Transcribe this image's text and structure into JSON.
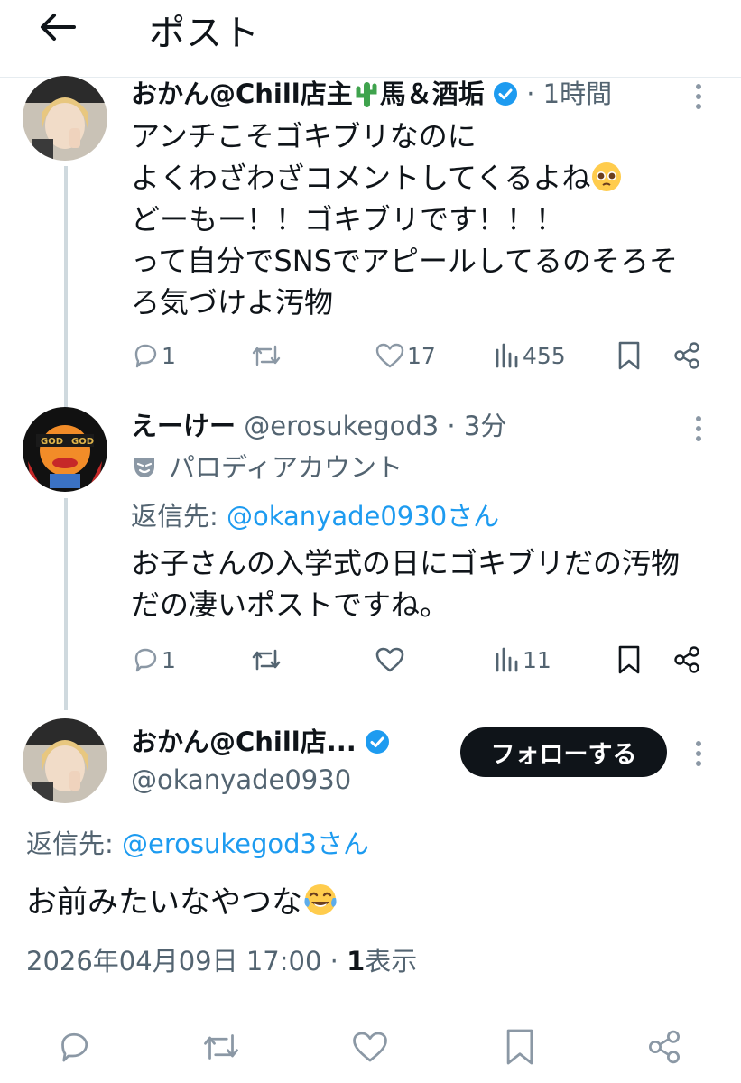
{
  "header": {
    "title": "ポスト",
    "back_icon": "arrow-left-icon"
  },
  "tweet1": {
    "display_name": "おかん@Chill店主",
    "display_name_suffix": "馬＆酒垢",
    "inline_emoji": "cactus",
    "verified": true,
    "time_sep": " · ",
    "time": "1時間",
    "lines": [
      "アンチこそゴキブリなのに",
      "よくわざわざコメントしてくるよね",
      "どーもー！！ゴキブリです！！！",
      "って自分でSNSでアピールしてるのそろそ",
      "ろ気づけよ汚物"
    ],
    "line2_emoji": "pleading-face",
    "stats": {
      "replies": "1",
      "likes": "17",
      "views": "455"
    }
  },
  "tweet2": {
    "display_name": "えーけー",
    "handle": "@erosukegod3",
    "time_sep": " · ",
    "time": "3分",
    "parody_label": "パロディアカウント",
    "reply_prefix": "返信先: ",
    "reply_target": "@okanyade0930さん",
    "lines": [
      "お子さんの入学式の日にゴキブリだの汚物",
      "だの凄いポストですね。"
    ],
    "stats": {
      "replies": "1",
      "views": "11"
    }
  },
  "main": {
    "display_name": "おかん@Chill店...",
    "handle": "@okanyade0930",
    "follow_label": "フォローする",
    "reply_prefix": "返信先: ",
    "reply_target": "@erosukegod3さん",
    "text": "お前みたいなやつな",
    "text_emoji": "face-with-tears-of-joy",
    "datetime": "2026年04月09日 17:00",
    "meta_sep": " · ",
    "view_count": "1",
    "view_label": "表示"
  },
  "colors": {
    "link": "#1d9bf0",
    "verified": "#1d9bf0",
    "muted": "#536471",
    "thread_line": "#cfd9de",
    "follow_bg": "#0f1419"
  }
}
